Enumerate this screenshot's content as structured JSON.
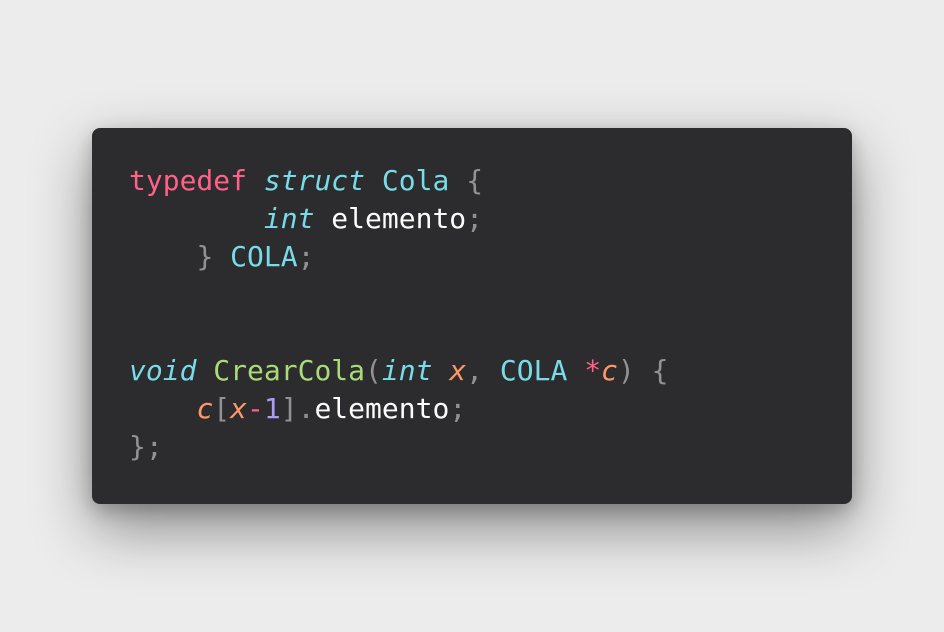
{
  "code": {
    "line1": {
      "typedef": "typedef",
      "space1": " ",
      "struct": "struct",
      "space2": " ",
      "name": "Cola",
      "space3": " ",
      "brace": "{"
    },
    "line2": {
      "indent": "        ",
      "type": "int",
      "space": " ",
      "field": "elemento",
      "semi": ";"
    },
    "line3": {
      "indent": "    ",
      "brace": "}",
      "space": " ",
      "alias": "COLA",
      "semi": ";"
    },
    "line4": {},
    "line5": {},
    "line6": {
      "void": "void",
      "space1": " ",
      "func": "CrearCola",
      "open_paren": "(",
      "int": "int",
      "space2": " ",
      "x": "x",
      "comma": ",",
      "space3": " ",
      "type": "COLA",
      "space4": " ",
      "star": "*",
      "c": "c",
      "close_paren": ")",
      "space5": " ",
      "brace": "{"
    },
    "line7": {
      "indent": "    ",
      "c": "c",
      "open_bracket": "[",
      "x": "x",
      "minus": "-",
      "one": "1",
      "close_bracket": "]",
      "dot": ".",
      "field": "elemento",
      "semi": ";"
    },
    "line8": {
      "close": "};"
    }
  }
}
